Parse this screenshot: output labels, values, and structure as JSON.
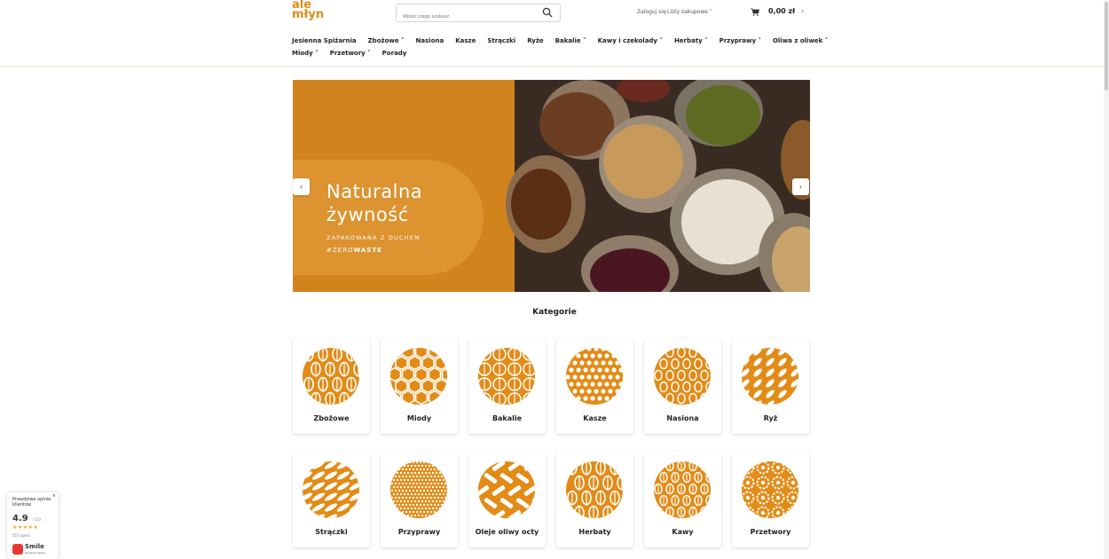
{
  "brand": {
    "line1": "ale",
    "line2": "młyn",
    "accent": "#e38b17"
  },
  "search": {
    "placeholder": "Wpisz czego szukasz"
  },
  "account": {
    "login": "Zaloguj się",
    "lists": "Listy zakupowe ˅"
  },
  "cart": {
    "amount": "0,00 zł",
    "arrow": "›"
  },
  "nav": {
    "row1": [
      "Jesienna Spiżarnia",
      "Zbożowe ˅",
      "Nasiona",
      "Kasze",
      "Strączki",
      "Ryże",
      "Bakalie ˅",
      "Kawy i czekolady ˅",
      "Herbaty ˅",
      "Przyprawy ˅",
      "Oliwa z oliwek ˅"
    ],
    "row2": [
      "Miody ˅",
      "Przetwory ˅",
      "Porady"
    ]
  },
  "banner": {
    "title1": "Naturalna",
    "title2": "żywność",
    "sub1": "ZAPAKOWANA Z DUCHEM",
    "sub2_prefix": "#ZERO",
    "sub2_bold": "WASTE",
    "prev": "‹",
    "next": "›"
  },
  "categories_title": "Kategorie",
  "categories_row1": [
    {
      "label": "Zbożowe",
      "pattern": "wheat-icon"
    },
    {
      "label": "Miody",
      "pattern": "honeycomb-icon"
    },
    {
      "label": "Bakalie",
      "pattern": "nuts-icon"
    },
    {
      "label": "Kasze",
      "pattern": "dots-icon"
    },
    {
      "label": "Nasiona",
      "pattern": "seeds-icon"
    },
    {
      "label": "Ryż",
      "pattern": "rice-icon"
    }
  ],
  "categories_row2": [
    {
      "label": "Strączki",
      "pattern": "pods-icon"
    },
    {
      "label": "Przyprawy",
      "pattern": "spice-dots-icon"
    },
    {
      "label": "Oleje oliwy octy",
      "pattern": "bottles-icon"
    },
    {
      "label": "Herbaty",
      "pattern": "leaves-icon"
    },
    {
      "label": "Kawy",
      "pattern": "coffee-beans-icon"
    },
    {
      "label": "Przetwory",
      "pattern": "flowers-icon"
    }
  ],
  "reviews": {
    "close": "×",
    "title": "Prawdziwe opinie klientów",
    "score": "4.9",
    "scale": "/ 5.0",
    "stars": "★★★★★",
    "count": "557 opinii",
    "brand": "Smile",
    "brand_sub": "Zaufane Opinie"
  },
  "colors": {
    "orange": "#e38b17",
    "banner": "#d1831e"
  }
}
